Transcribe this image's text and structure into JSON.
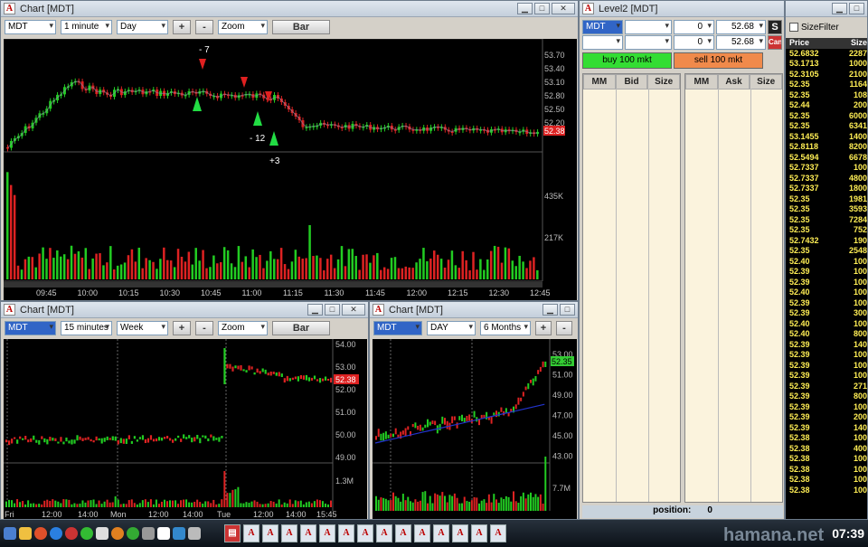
{
  "main_chart": {
    "title": "Chart [MDT]",
    "symbol": "MDT",
    "interval": "1 minute",
    "period": "Day",
    "plus": "+",
    "minus": "-",
    "zoom": "Zoom",
    "charttype": "Bar",
    "price_ticks": [
      "53.70",
      "53.40",
      "53.10",
      "52.80",
      "52.50",
      "52.20"
    ],
    "last_price": "52.38",
    "volume_ticks": [
      "435K",
      "217K"
    ],
    "time_ticks": [
      "09:45",
      "10:00",
      "10:15",
      "10:30",
      "10:45",
      "11:00",
      "11:15",
      "11:30",
      "11:45",
      "12:00",
      "12:15",
      "12:30",
      "12:45"
    ],
    "annotations": [
      "- 7",
      "- 12",
      "+3"
    ]
  },
  "chart_15m": {
    "title": "Chart [MDT]",
    "symbol": "MDT",
    "interval": "15 minutes",
    "period": "Week",
    "plus": "+",
    "minus": "-",
    "zoom": "Zoom",
    "charttype": "Bar",
    "price_ticks": [
      "54.00",
      "53.00",
      "52.00",
      "51.00",
      "50.00",
      "49.00"
    ],
    "last_price": "52.38",
    "volume_ticks": [
      "1.3M"
    ],
    "time_ticks": [
      "Fri",
      "12:00",
      "14:00",
      "Mon",
      "12:00",
      "14:00",
      "Tue",
      "12:00",
      "14:00",
      "15:45"
    ]
  },
  "chart_daily": {
    "title": "Chart [MDT]",
    "symbol": "MDT",
    "interval": "DAY",
    "period": "6 Months",
    "plus": "+",
    "minus": "-",
    "price_ticks": [
      "53.00",
      "51.00",
      "49.00",
      "47.00",
      "45.00",
      "43.00"
    ],
    "last_price": "52.35",
    "volume_ticks": [
      "7.7M"
    ]
  },
  "level2": {
    "title": "Level2 [MDT]",
    "symbol": "MDT",
    "qty1": "0",
    "price1": "52.68",
    "qty2": "0",
    "price2": "52.68",
    "btn_s": "S",
    "btn_can": "Can",
    "buy_label": "buy 100 mkt",
    "sell_label": "sell 100 mkt",
    "bid_headers": [
      "MM",
      "Bid",
      "Size"
    ],
    "ask_headers": [
      "MM",
      "Ask",
      "Size"
    ],
    "position_label": "position:",
    "position_value": "0"
  },
  "tape": {
    "filter_label": "SizeFilter",
    "headers": [
      "Price",
      "Size"
    ],
    "rows": [
      [
        "52.6832",
        "2287"
      ],
      [
        "53.1713",
        "1000"
      ],
      [
        "52.3105",
        "2100"
      ],
      [
        "52.35",
        "1164"
      ],
      [
        "52.35",
        "108"
      ],
      [
        "52.44",
        "200"
      ],
      [
        "52.35",
        "6000"
      ],
      [
        "52.35",
        "6341"
      ],
      [
        "53.1455",
        "1400"
      ],
      [
        "52.8118",
        "8200"
      ],
      [
        "52.5494",
        "6678"
      ],
      [
        "52.7337",
        "100"
      ],
      [
        "52.7337",
        "4800"
      ],
      [
        "52.7337",
        "1800"
      ],
      [
        "52.35",
        "1981"
      ],
      [
        "52.35",
        "3593"
      ],
      [
        "52.35",
        "7284"
      ],
      [
        "52.35",
        "752"
      ],
      [
        "52.7432",
        "190"
      ],
      [
        "52.35",
        "2548"
      ],
      [
        "52.40",
        "100"
      ],
      [
        "52.39",
        "100"
      ],
      [
        "52.39",
        "100"
      ],
      [
        "52.40",
        "100"
      ],
      [
        "52.39",
        "100"
      ],
      [
        "52.39",
        "300"
      ],
      [
        "52.40",
        "100"
      ],
      [
        "52.40",
        "800"
      ],
      [
        "52.39",
        "140"
      ],
      [
        "52.39",
        "100"
      ],
      [
        "52.39",
        "100"
      ],
      [
        "52.39",
        "100"
      ],
      [
        "52.39",
        "271"
      ],
      [
        "52.39",
        "800"
      ],
      [
        "52.39",
        "100"
      ],
      [
        "52.39",
        "200"
      ],
      [
        "52.39",
        "140"
      ],
      [
        "52.38",
        "100"
      ],
      [
        "52.38",
        "400"
      ],
      [
        "52.38",
        "100"
      ],
      [
        "52.38",
        "100"
      ],
      [
        "52.38",
        "100"
      ],
      [
        "52.38",
        "100"
      ]
    ]
  },
  "taskbar": {
    "clock": "07:39",
    "watermark": "hamana.net"
  },
  "colors": {
    "up": "#22cc22",
    "down": "#dd2222",
    "accent_buy": "#33dd33",
    "accent_sell": "#f08a4b"
  }
}
